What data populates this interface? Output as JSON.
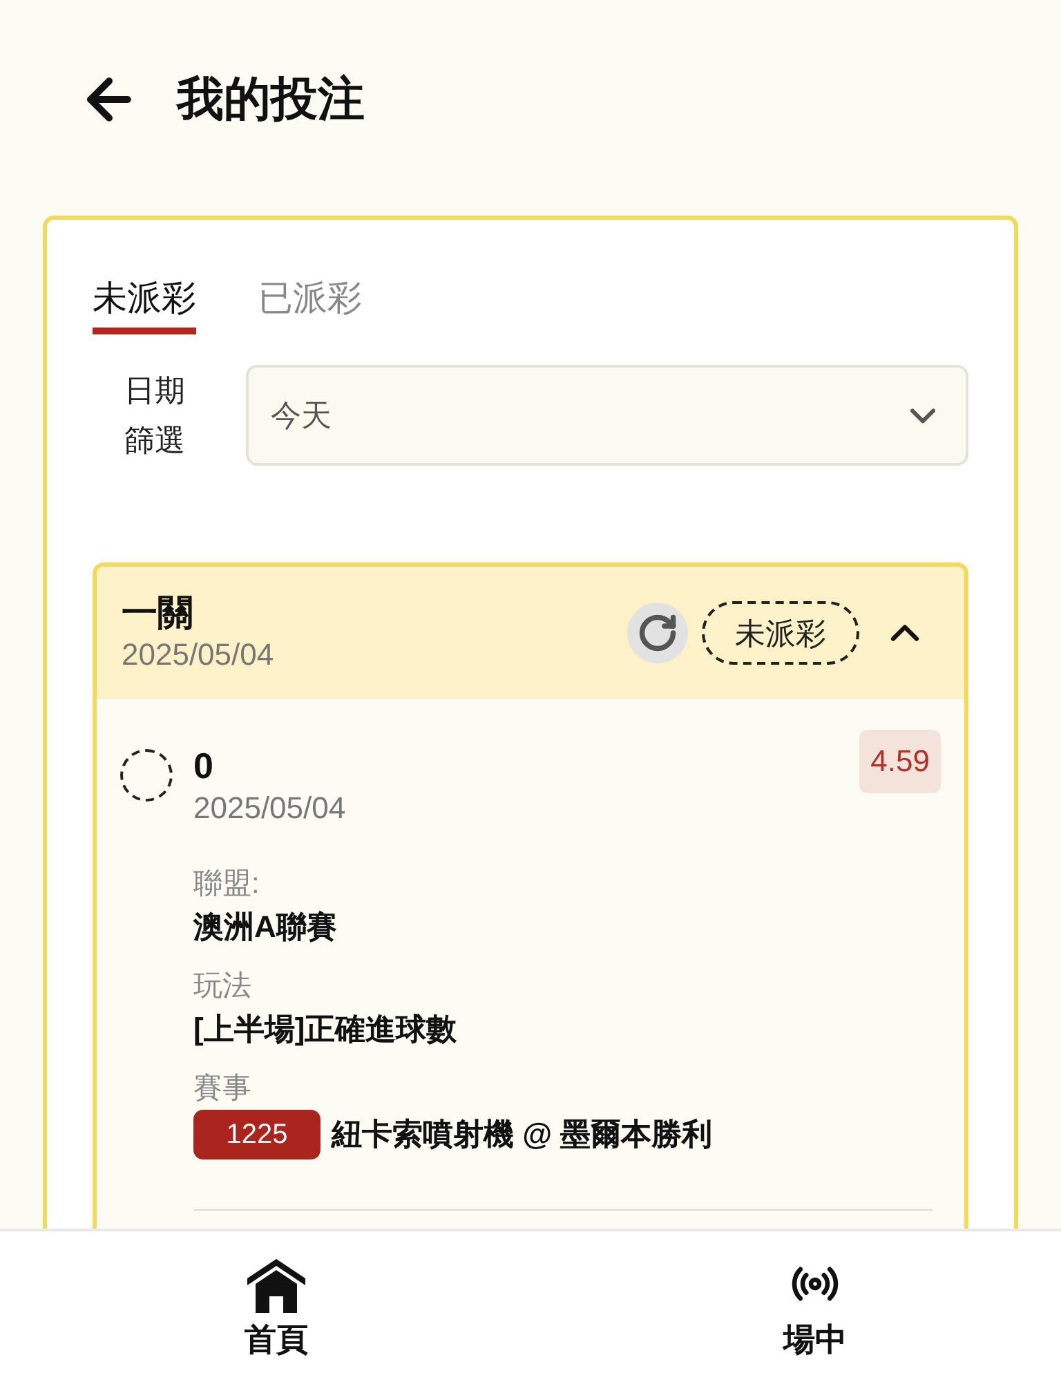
{
  "header": {
    "title": "我的投注"
  },
  "tabs": [
    {
      "label": "未派彩",
      "selected": true
    },
    {
      "label": "已派彩",
      "selected": false
    }
  ],
  "date_filter": {
    "label": "日期篩選",
    "value": "今天"
  },
  "bets": [
    {
      "type": "一關",
      "date": "2025/05/04",
      "status": "未派彩",
      "expanded": true,
      "selections": [
        {
          "name": "0",
          "date": "2025/05/04",
          "odds": "4.59",
          "details": [
            {
              "label": "聯盟:",
              "value": "澳洲A聯賽"
            },
            {
              "label": "玩法",
              "value": "[上半場]正確進球數"
            },
            {
              "label": "賽事",
              "match_number": "1225",
              "value": "紐卡索噴射機 @ 墨爾本勝利"
            }
          ]
        }
      ]
    }
  ],
  "bottom_nav": [
    {
      "kind": "home",
      "label": "首頁"
    },
    {
      "kind": "live",
      "label": "場中"
    }
  ]
}
